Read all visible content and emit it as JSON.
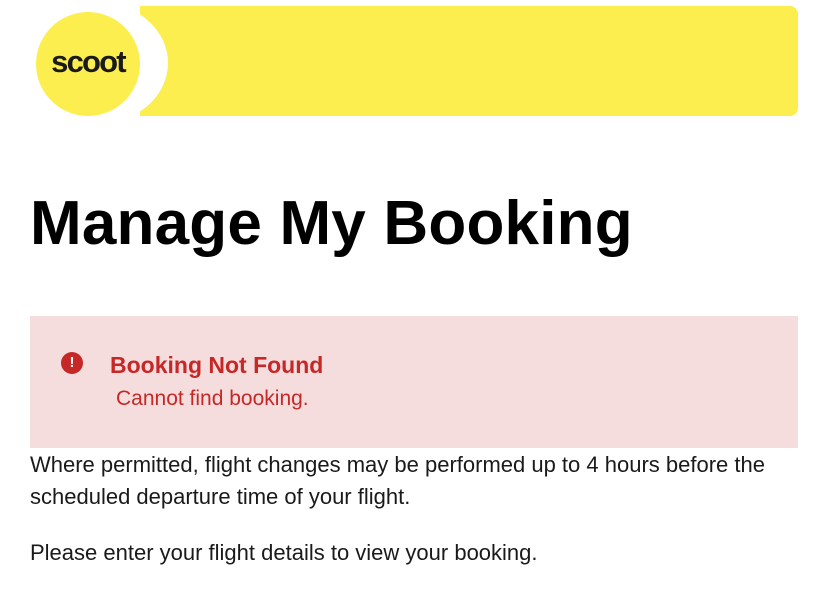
{
  "header": {
    "logo_text": "scoot",
    "brand_color": "#fcee4f"
  },
  "page": {
    "title": "Manage My Booking"
  },
  "alert": {
    "icon": "exclamation-circle-icon",
    "icon_glyph": "!",
    "title": "Booking Not Found",
    "message": "Cannot find booking.",
    "background_color": "#f6dddd",
    "text_color": "#c62828"
  },
  "info": {
    "change_notice": "Where permitted, flight changes may be performed up to 4 hours before the scheduled departure time of your flight.",
    "instruction": "Please enter your flight details to view your booking."
  }
}
